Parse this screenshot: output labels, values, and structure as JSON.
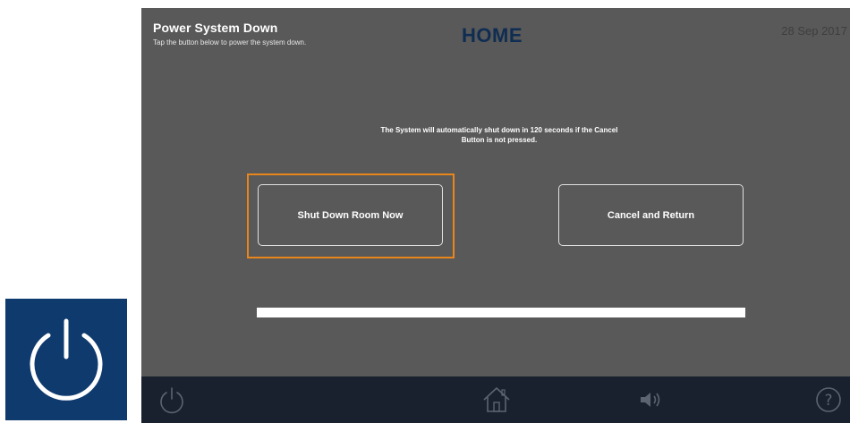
{
  "panel": {
    "title": "Power System Down",
    "subtitle": "Tap the button below to power the system down.",
    "home_title": "HOME",
    "date": "28 Sep 2017"
  },
  "message": {
    "line1": "The System will automatically shut down in 120 seconds if the Cancel",
    "line2": "Button is not pressed."
  },
  "buttons": {
    "shutdown_label": "Shut Down Room Now",
    "cancel_label": "Cancel and Return"
  },
  "progress": {
    "fraction": 1.0
  },
  "bottom_bar": {
    "icons": [
      "power-icon",
      "home-icon",
      "volume-icon",
      "help-icon"
    ]
  },
  "colors": {
    "panel_bg": "#595959",
    "bottom_bar_bg": "#18212d",
    "tile_bg": "#0f3a6e",
    "focus_ring": "#e8861c",
    "home_title": "#0f2d52"
  }
}
